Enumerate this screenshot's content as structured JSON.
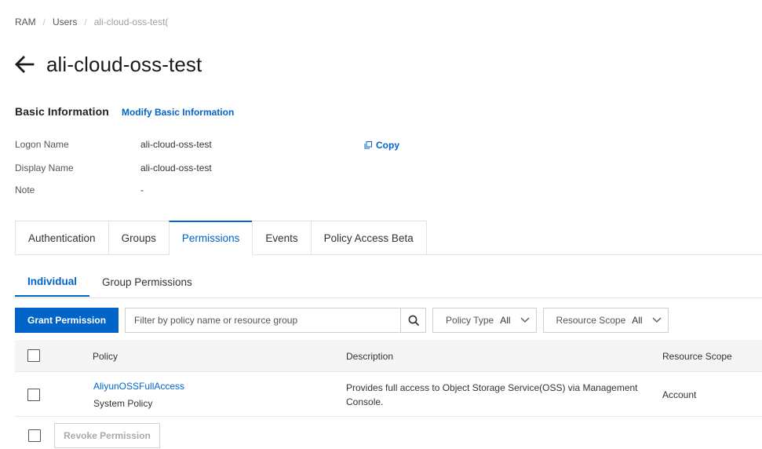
{
  "breadcrumb": {
    "items": [
      "RAM",
      "Users",
      "ali-cloud-oss-test("
    ],
    "separator": "/"
  },
  "header": {
    "title": "ali-cloud-oss-test"
  },
  "basic_info": {
    "section_title": "Basic Information",
    "modify_link": "Modify Basic Information",
    "logon_name_label": "Logon Name",
    "logon_name_value": "ali-cloud-oss-test",
    "display_name_label": "Display Name",
    "display_name_value": "ali-cloud-oss-test",
    "note_label": "Note",
    "note_value": "-",
    "copy_label": "Copy"
  },
  "tabs": [
    {
      "label": "Authentication",
      "active": false
    },
    {
      "label": "Groups",
      "active": false
    },
    {
      "label": "Permissions",
      "active": true
    },
    {
      "label": "Events",
      "active": false
    },
    {
      "label": "Policy Access Beta",
      "active": false
    }
  ],
  "subtabs": [
    {
      "label": "Individual",
      "active": true
    },
    {
      "label": "Group Permissions",
      "active": false
    }
  ],
  "toolbar": {
    "grant_button": "Grant Permission",
    "search_placeholder": "Filter by policy name or resource group",
    "policy_type_label": "Policy Type",
    "policy_type_value": "All",
    "resource_scope_label": "Resource Scope",
    "resource_scope_value": "All"
  },
  "table": {
    "columns": [
      "Policy",
      "Description",
      "Resource Scope"
    ],
    "rows": [
      {
        "policy_name": "AliyunOSSFullAccess",
        "policy_type": "System Policy",
        "description_line1": "Provides full access to Object Storage Service(OSS) via Management",
        "description_line2": "Console.",
        "resource_scope": "Account"
      }
    ]
  },
  "footer": {
    "revoke_button": "Revoke Permission"
  },
  "colors": {
    "accent": "#0064c8",
    "header_bg": "#f5f5f5",
    "border": "#e3e3e3"
  }
}
